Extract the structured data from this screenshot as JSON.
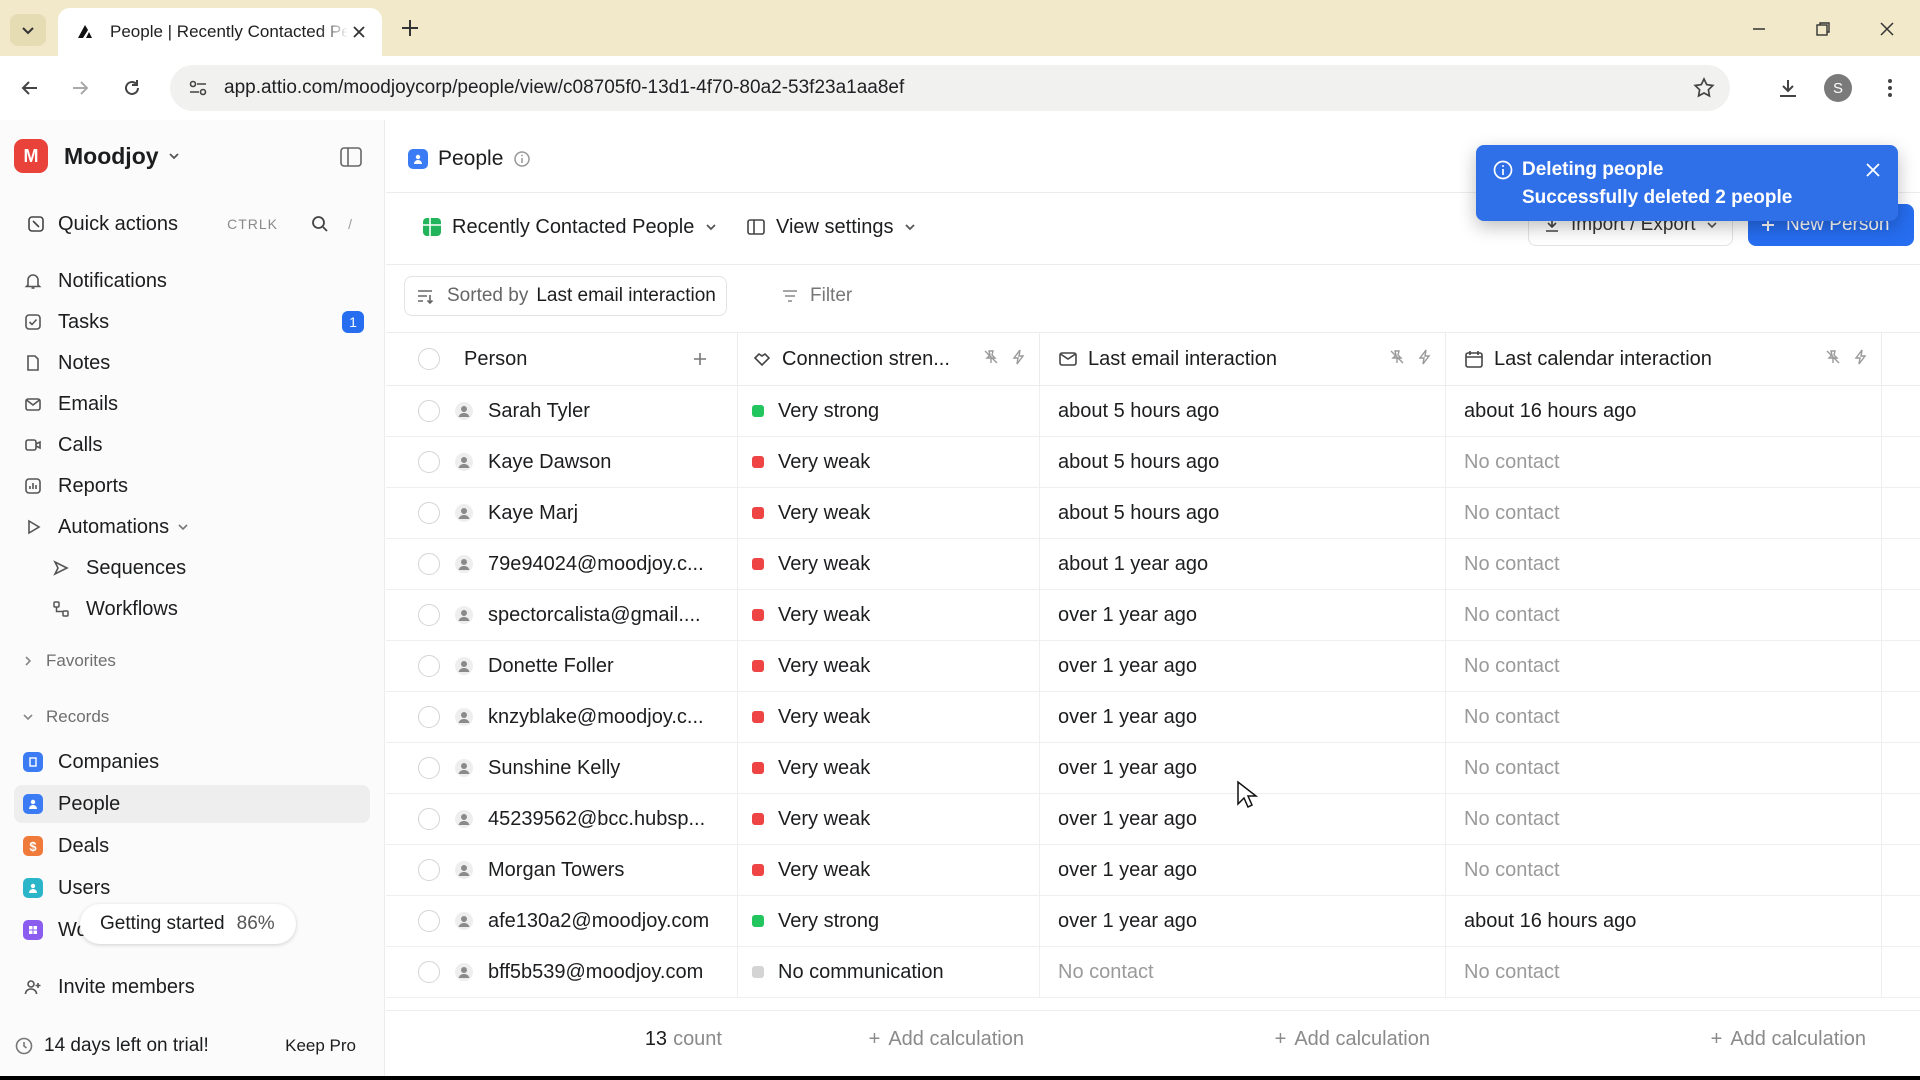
{
  "browser": {
    "tab_title": "People | Recently Contacted Pe",
    "url": "app.attio.com/moodjoycorp/people/view/c08705f0-13d1-4f70-80a2-53f23a1aa8ef",
    "profile_initial": "S"
  },
  "sidebar": {
    "workspace": "Moodjoy",
    "workspace_initial": "M",
    "quick_actions": "Quick actions",
    "quick_actions_kbd": "CTRLK",
    "search_kbd": "/",
    "nav": [
      {
        "label": "Notifications",
        "icon": "bell-icon"
      },
      {
        "label": "Tasks",
        "icon": "checkbox-icon",
        "badge": "1"
      },
      {
        "label": "Notes",
        "icon": "note-icon"
      },
      {
        "label": "Emails",
        "icon": "mail-icon"
      },
      {
        "label": "Calls",
        "icon": "video-icon"
      },
      {
        "label": "Reports",
        "icon": "chart-icon"
      },
      {
        "label": "Automations",
        "icon": "play-icon"
      },
      {
        "label": "Sequences",
        "icon": "send-icon"
      },
      {
        "label": "Workflows",
        "icon": "workflow-icon"
      }
    ],
    "favorites": "Favorites",
    "records": "Records",
    "record_items": [
      {
        "label": "Companies",
        "color": "#3b7cf5"
      },
      {
        "label": "People",
        "color": "#3b7cf5"
      },
      {
        "label": "Deals",
        "color": "#f07a3a"
      },
      {
        "label": "Users",
        "color": "#2bb5c9"
      },
      {
        "label": "Wor",
        "color": "#8a5cf0"
      }
    ],
    "getting_started": "Getting started",
    "getting_started_pct": "86%",
    "invite": "Invite members",
    "trial": "14 days left on trial!",
    "keep_pro": "Keep Pro"
  },
  "header": {
    "title": "People",
    "view_name": "Recently Contacted People",
    "view_settings": "View settings",
    "import_export": "Import / Export",
    "new_person": "New Person",
    "sorted_by_prefix": "Sorted by",
    "sorted_by_value": "Last email interaction",
    "filter": "Filter"
  },
  "table": {
    "columns": [
      "Person",
      "Connection stren...",
      "Last email interaction",
      "Last calendar interaction"
    ],
    "rows": [
      {
        "person": "Sarah Tyler",
        "strength": "Very strong",
        "level": "strong",
        "email": "about 5 hours ago",
        "calendar": "about 16 hours ago"
      },
      {
        "person": "Kaye Dawson",
        "strength": "Very weak",
        "level": "weak",
        "email": "about 5 hours ago",
        "calendar": "No contact"
      },
      {
        "person": "Kaye Marj",
        "strength": "Very weak",
        "level": "weak",
        "email": "about 5 hours ago",
        "calendar": "No contact"
      },
      {
        "person": "79e94024@moodjoy.c...",
        "strength": "Very weak",
        "level": "weak",
        "email": "about 1 year ago",
        "calendar": "No contact"
      },
      {
        "person": "spectorcalista@gmail....",
        "strength": "Very weak",
        "level": "weak",
        "email": "over 1 year ago",
        "calendar": "No contact"
      },
      {
        "person": "Donette Foller",
        "strength": "Very weak",
        "level": "weak",
        "email": "over 1 year ago",
        "calendar": "No contact"
      },
      {
        "person": "knzyblake@moodjoy.c...",
        "strength": "Very weak",
        "level": "weak",
        "email": "over 1 year ago",
        "calendar": "No contact"
      },
      {
        "person": "Sunshine Kelly",
        "strength": "Very weak",
        "level": "weak",
        "email": "over 1 year ago",
        "calendar": "No contact"
      },
      {
        "person": "45239562@bcc.hubsp...",
        "strength": "Very weak",
        "level": "weak",
        "email": "over 1 year ago",
        "calendar": "No contact"
      },
      {
        "person": "Morgan Towers",
        "strength": "Very weak",
        "level": "weak",
        "email": "over 1 year ago",
        "calendar": "No contact"
      },
      {
        "person": "afe130a2@moodjoy.com",
        "strength": "Very strong",
        "level": "strong",
        "email": "over 1 year ago",
        "calendar": "about 16 hours ago"
      },
      {
        "person": "bff5b539@moodjoy.com",
        "strength": "No communication",
        "level": "none",
        "email": "No contact",
        "calendar": "No contact"
      }
    ],
    "count_num": "13",
    "count_word": "count",
    "add_calculation": "Add calculation",
    "level_colors": {
      "strong": "#22c55e",
      "weak": "#ef4444",
      "none": "#d4d4d4"
    }
  },
  "toast": {
    "title": "Deleting people",
    "message": "Successfully deleted 2 people"
  }
}
